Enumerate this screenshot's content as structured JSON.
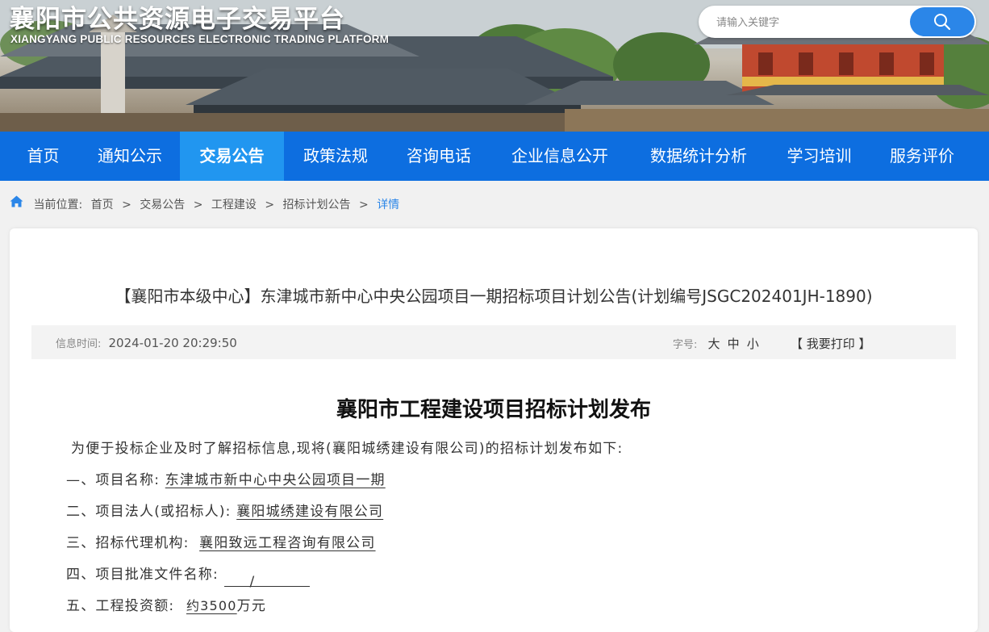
{
  "header": {
    "title": "襄阳市公共资源电子交易平台",
    "subtitle": "XIANGYANG PUBLIC RESOURCES ELECTRONIC TRADING PLATFORM"
  },
  "search": {
    "placeholder": "请输入关键字",
    "icon": "search-icon"
  },
  "nav": {
    "items": [
      {
        "label": "首页",
        "active": false
      },
      {
        "label": "通知公示",
        "active": false
      },
      {
        "label": "交易公告",
        "active": true
      },
      {
        "label": "政策法规",
        "active": false
      },
      {
        "label": "咨询电话",
        "active": false
      },
      {
        "label": "企业信息公开",
        "active": false
      },
      {
        "label": "数据统计分析",
        "active": false
      },
      {
        "label": "学习培训",
        "active": false
      },
      {
        "label": "服务评价",
        "active": false
      }
    ]
  },
  "breadcrumb": {
    "icon": "home-icon",
    "prefix": "当前位置:",
    "items": [
      "首页",
      "交易公告",
      "工程建设",
      "招标计划公告"
    ],
    "separator": ">",
    "current": "详情"
  },
  "article": {
    "title": "【襄阳市本级中心】东津城市新中心中央公园项目一期招标项目计划公告(计划编号JSGC202401JH-1890)",
    "meta": {
      "time_label": "信息时间:",
      "time_value": "2024-01-20 20:29:50",
      "font_label": "字号:",
      "font_large": "大",
      "font_medium": "中",
      "font_small": "小",
      "print": "【 我要打印 】"
    },
    "doc": {
      "heading": "襄阳市工程建设项目招标计划发布",
      "intro": "为便于投标企业及时了解招标信息,现将(襄阳城绣建设有限公司)的招标计划发布如下:",
      "item1_label": "—、项目名称:",
      "item1_value": "东津城市新中心中央公园项目一期",
      "item2_label": "二、项目法人(或招标人):",
      "item2_value": "襄阳城绣建设有限公司",
      "item3_label": "三、招标代理机构:",
      "item3_value": "襄阳致远工程咨询有限公司",
      "item4_label": "四、项目批准文件名称:",
      "item4_value": "/",
      "item5_label": "五、工程投资额:",
      "item5_value": "约3500",
      "item5_unit": "万元"
    }
  },
  "colors": {
    "nav_bg": "#0d6ee0",
    "nav_active": "#2196f0",
    "accent": "#2b86e8"
  }
}
